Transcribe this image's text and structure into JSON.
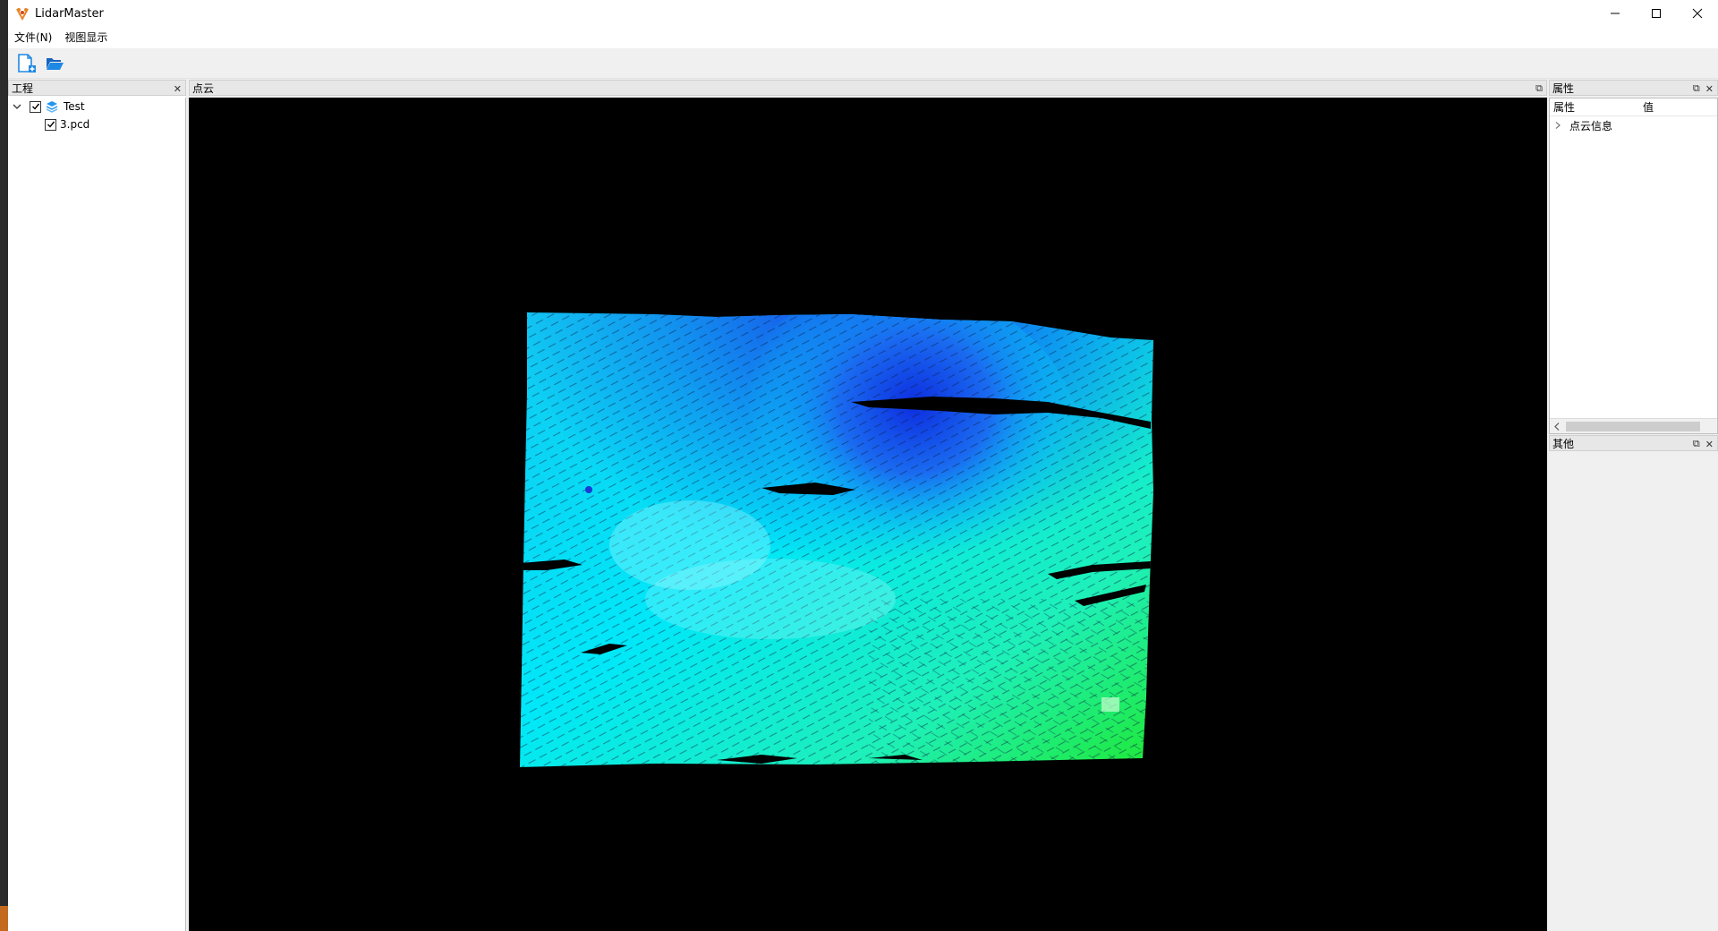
{
  "app": {
    "title": "LidarMaster"
  },
  "menu": {
    "items": [
      "文件(N)",
      "视图显示"
    ]
  },
  "toolbar": {
    "new_project_icon": "new-project-icon",
    "open_folder_icon": "open-folder-icon"
  },
  "project_panel": {
    "title": "工程",
    "tree": {
      "root_label": "Test",
      "root_checked": true,
      "root_expanded": true,
      "child_label": "3.pcd",
      "child_checked": true
    }
  },
  "viewer_panel": {
    "title": "点云",
    "background": "#000000",
    "colormap": [
      "#0a2fe0",
      "#00e6ff",
      "#19f02a"
    ]
  },
  "property_panel": {
    "title": "属性",
    "col_property": "属性",
    "col_value": "值",
    "group_label": "点云信息"
  },
  "other_panel": {
    "title": "其他"
  },
  "colors": {
    "accent": "#1e88e5",
    "panel_bg": "#f0f0f0"
  }
}
